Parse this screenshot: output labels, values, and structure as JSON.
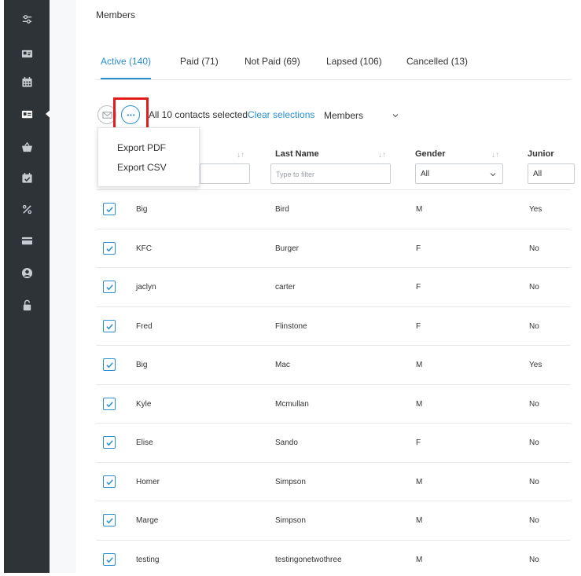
{
  "sidebar": {
    "icons": [
      "sliders-icon",
      "id-card-icon",
      "calendar-icon",
      "contact-card-icon",
      "basket-icon",
      "calendar-check-icon",
      "percent-icon",
      "credit-card-icon",
      "user-circle-icon",
      "unlock-icon"
    ],
    "active_index": 3
  },
  "page": {
    "title": "Members"
  },
  "tabs": [
    {
      "label": "Active (140)",
      "active": true
    },
    {
      "label": "Paid (71)",
      "active": false
    },
    {
      "label": "Not Paid (69)",
      "active": false
    },
    {
      "label": "Lapsed (106)",
      "active": false
    },
    {
      "label": "Cancelled (13)",
      "active": false
    }
  ],
  "toolbar": {
    "selection_text": "All 10 contacts selected",
    "clear_label": "Clear selections",
    "view_dropdown": "Members"
  },
  "menu": {
    "items": [
      "Export PDF",
      "Export CSV"
    ]
  },
  "table": {
    "columns": [
      {
        "label": "Last Name",
        "filter_placeholder": "Type to filter"
      },
      {
        "label": "Gender",
        "filter_value": "All"
      },
      {
        "label": "Junior",
        "filter_value": "All"
      }
    ],
    "rows": [
      {
        "first": "Big",
        "last": "Bird",
        "gender": "M",
        "junior": "Yes"
      },
      {
        "first": "KFC",
        "last": "Burger",
        "gender": "F",
        "junior": "No"
      },
      {
        "first": "jaclyn",
        "last": "carter",
        "gender": "F",
        "junior": "No"
      },
      {
        "first": "Fred",
        "last": "Flinstone",
        "gender": "F",
        "junior": "No"
      },
      {
        "first": "Big",
        "last": "Mac",
        "gender": "M",
        "junior": "Yes"
      },
      {
        "first": "Kyle",
        "last": "Mcmullan",
        "gender": "M",
        "junior": "No"
      },
      {
        "first": "Elise",
        "last": "Sando",
        "gender": "F",
        "junior": "No"
      },
      {
        "first": "Homer",
        "last": "Simpson",
        "gender": "M",
        "junior": "No"
      },
      {
        "first": "Marge",
        "last": "Simpson",
        "gender": "M",
        "junior": "No"
      },
      {
        "first": "testing",
        "last": "testingonetwothree",
        "gender": "M",
        "junior": "No"
      }
    ]
  },
  "colors": {
    "accent": "#2a8fcf",
    "sidebar": "#2e3338",
    "highlight": "#e41b1b"
  }
}
